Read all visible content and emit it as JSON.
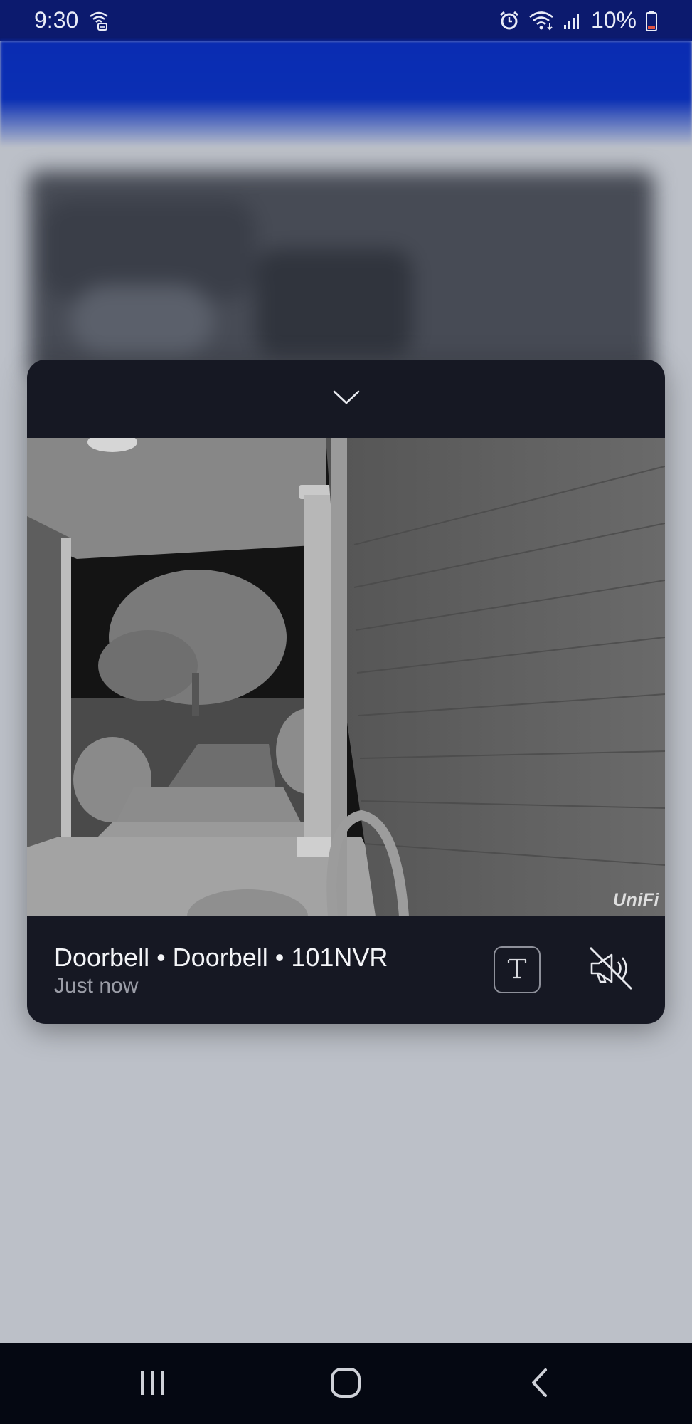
{
  "status_bar": {
    "time": "9:30",
    "battery": "10%",
    "icons": [
      "wifi-call-icon",
      "alarm-icon",
      "wifi-icon",
      "signal-icon",
      "battery-low-icon"
    ]
  },
  "notification": {
    "collapse_icon": "chevron-down-icon",
    "title": "Doorbell • Doorbell • 101NVR",
    "time": "Just now",
    "watermark": "UniFi",
    "text_button_icon": "text-icon",
    "mute_button_icon": "speaker-muted-icon"
  },
  "nav_bar": {
    "buttons": [
      "recent-apps-icon",
      "home-icon",
      "back-icon"
    ]
  },
  "colors": {
    "status_bar": "#0c1a6e",
    "app_header": "#0b2fb4",
    "notification_bg": "#161823",
    "nav_bar": "#050812",
    "battery_low": "#e05545"
  }
}
